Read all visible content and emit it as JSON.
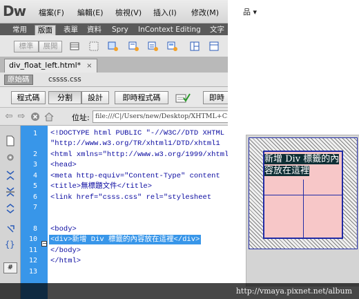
{
  "app": {
    "logo": "Dw"
  },
  "menu": [
    "檔案(F)",
    "編輯(E)",
    "檢視(V)",
    "插入(I)",
    "修改(M)"
  ],
  "menu_tail": "品 ▾",
  "insert_tabs": [
    "常用",
    "版面",
    "表單",
    "資料",
    "Spry",
    "InContext Editing",
    "文字"
  ],
  "insert_active": "版面",
  "layout_buttons": {
    "standard": "標準",
    "expanded": "展開"
  },
  "document": {
    "tab_title": "div_float_left.html*",
    "tab_close": "×",
    "source_button": "原始碼",
    "related_file": "cssss.css"
  },
  "view_buttons": {
    "code": "程式碼",
    "split": "分割",
    "design": "設計",
    "live_code": "即時程式碼",
    "live_view": "即時"
  },
  "address": {
    "label": "位址:",
    "value": "file:///C|/Users/new/Desktop/XHTML+CSS"
  },
  "code_lines": [
    {
      "num": "1",
      "text": "<!DOCTYPE html PUBLIC \"-//W3C//DTD XHTML"
    },
    {
      "num": "",
      "text": "\"http://www.w3.org/TR/xhtml1/DTD/xhtml1"
    },
    {
      "num": "2",
      "text": "<html xmlns=\"http://www.w3.org/1999/xhtml"
    },
    {
      "num": "3",
      "text": "<head>"
    },
    {
      "num": "4",
      "text": "<meta http-equiv=\"Content-Type\" content"
    },
    {
      "num": "5",
      "text": "<title>無標題文件</title>"
    },
    {
      "num": "6",
      "text": "<link href=\"csss.css\" rel=\"stylesheet"
    },
    {
      "num": "7",
      "text": ""
    },
    {
      "num": "8",
      "text": "<body>"
    },
    {
      "num": "10",
      "text": "<div>新增 Div 標籤的內容放在這裡</div>"
    },
    {
      "num": "11",
      "text": "</body>"
    },
    {
      "num": "12",
      "text": "</html>"
    },
    {
      "num": "13",
      "text": ""
    }
  ],
  "fold_marker": "−",
  "preview": {
    "div_text": "新增 Div 標籤的內容放在這裡"
  },
  "watermark": "http://vmaya.pixnet.net/album",
  "colors": {
    "gutter": "#3896e9",
    "selection": "#3896e9",
    "div_border": "#1f2aa5",
    "div_fill": "#f7c7c8"
  }
}
